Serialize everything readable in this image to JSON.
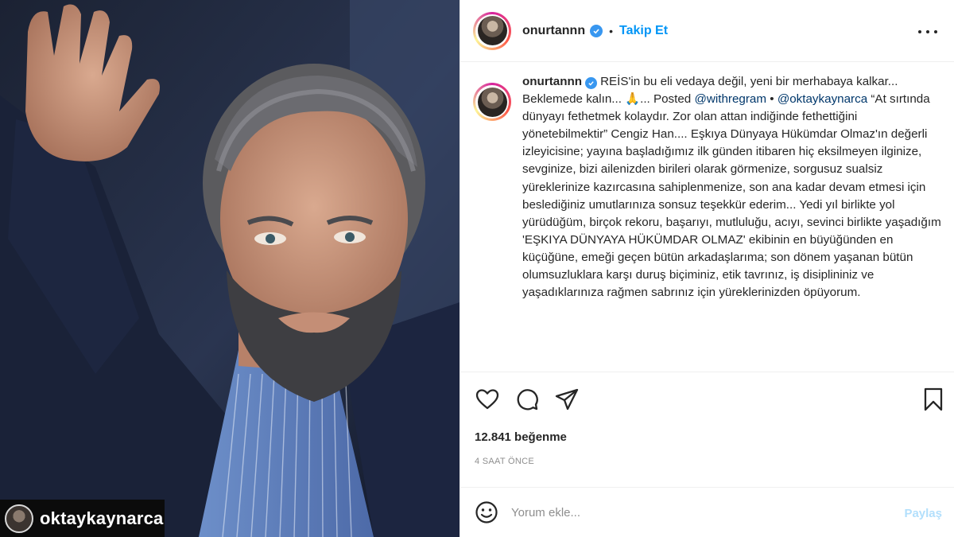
{
  "photo": {
    "repost_username": "oktaykaynarca"
  },
  "post": {
    "username": "onurtannn",
    "follow_label": "Takip Et",
    "separator": "•",
    "caption": {
      "line1_rest": "REİS'in bu eli vedaya değil, yeni bir merhabaya",
      "line2": "kalkar... Beklemede kalın... ",
      "prayer_emoji": "🙏",
      "line2_after": "... Posted ",
      "mention_withregram": "@withregram",
      "line2_end": " •",
      "mention_oktay": "@oktaykaynarca",
      "body": " “At sırtında dünyayı fethetmek kolaydır. Zor olan attan indiğinde fethettiğini yönetebilmektir” Cengiz Han.... Eşkıya Dünyaya Hükümdar Olmaz'ın değerli izleyicisine; yayına başladığımız ilk günden itibaren hiç eksilmeyen ilginize, sevginize, bizi ailenizden birileri olarak görmenize, sorgusuz sualsiz yüreklerinize kazırcasına sahiplenmenize, son ana kadar devam etmesi için beslediğiniz umutlarınıza sonsuz teşekkür ederim... Yedi yıl birlikte yol yürüdüğüm, birçok rekoru, başarıyı, mutluluğu, acıyı, sevinci birlikte yaşadığım 'EŞKIYA DÜNYAYA HÜKÜMDAR OLMAZ' ekibinin en büyüğünden en küçüğüne, emeği geçen bütün arkadaşlarıma; son dönem yaşanan bütün olumsuzluklara karşı duruş biçiminiz, etik tavrınız, iş disiplininiz ve yaşadıklarınıza rağmen sabrınız için yüreklerinizden öpüyorum."
    },
    "likes": "12.841 beğenme",
    "time": "4 SAAT ÖNCE"
  },
  "comment": {
    "placeholder": "Yorum ekle...",
    "post_label": "Paylaş"
  },
  "colors": {
    "link_blue": "#0095f6",
    "mention": "#00376b",
    "verified": "#3897f0",
    "muted": "#8e8e8e",
    "post_disabled": "#b2dffc"
  },
  "icons": [
    "more-options-icon",
    "verified-icon",
    "heart-icon",
    "comment-icon",
    "share-icon",
    "bookmark-icon",
    "emoji-icon"
  ]
}
